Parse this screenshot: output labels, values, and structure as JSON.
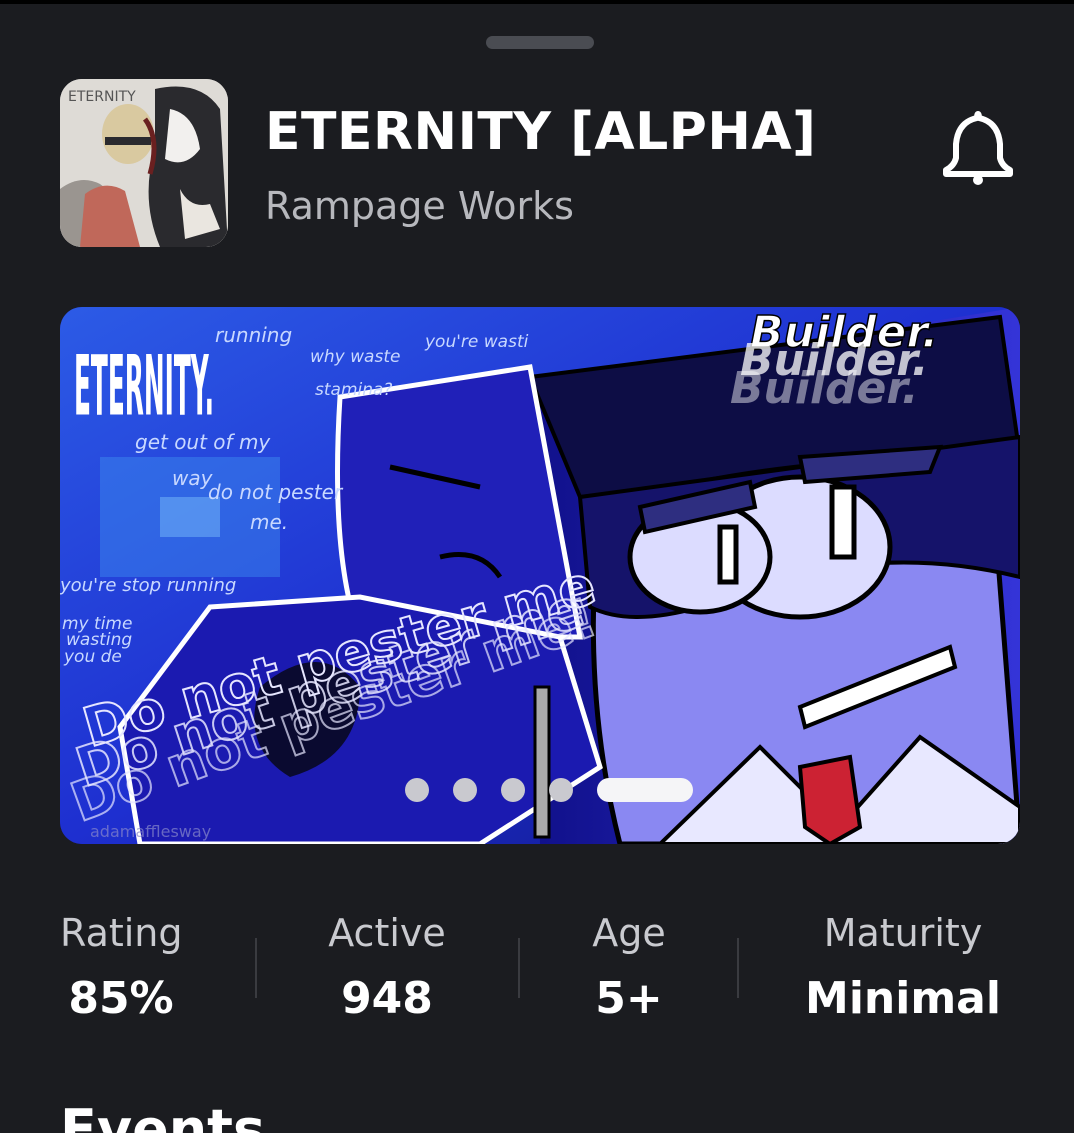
{
  "game": {
    "title": "ETERNITY [ALPHA]",
    "creator": "Rampage Works",
    "icon_text": "ETERNITY"
  },
  "carousel": {
    "slide_count": 5,
    "active_index": 4,
    "art_text": {
      "logo": "ETERNITY.",
      "builder": "Builder.",
      "scribble_1": "running",
      "scribble_2": "why waste",
      "scribble_3": "stamina?",
      "scribble_4": "you're wasti",
      "scribble_5": "get out of my",
      "scribble_6": "way",
      "scribble_7": "do not pester",
      "scribble_8": "me.",
      "scribble_9": "you're stop running",
      "scribble_10": "my time",
      "scribble_11": "wasting",
      "scribble_12": "you de",
      "big_1": "Do not pester me",
      "big_2": "Do not pester me",
      "big_3": "Do not pester me!",
      "signature": "adamafflesway"
    }
  },
  "stats": [
    {
      "label": "Rating",
      "value": "85%"
    },
    {
      "label": "Active",
      "value": "948"
    },
    {
      "label": "Age",
      "value": "5+"
    },
    {
      "label": "Maturity",
      "value": "Minimal"
    }
  ],
  "sections": {
    "events_title": "Events"
  },
  "colors": {
    "background": "#1b1c20",
    "text_primary": "#ffffff",
    "text_secondary": "#b7b8bd",
    "art_blue": "#2b2bd6"
  }
}
